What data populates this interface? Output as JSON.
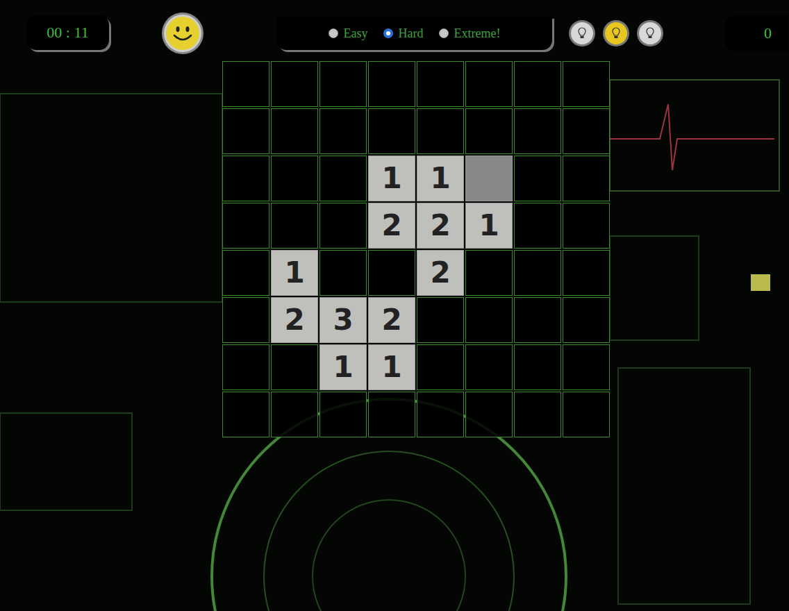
{
  "timer": "00 : 11",
  "difficulty": [
    {
      "label": "Easy",
      "selected": false
    },
    {
      "label": "Hard",
      "selected": true
    },
    {
      "label": "Extreme!",
      "selected": false
    }
  ],
  "hints": [
    {
      "selected": false
    },
    {
      "selected": true
    },
    {
      "selected": false
    }
  ],
  "score": "0",
  "board": {
    "rows": [
      [
        {
          "state": "hidden",
          "value": ""
        },
        {
          "state": "hidden",
          "value": ""
        },
        {
          "state": "hidden",
          "value": ""
        },
        {
          "state": "hidden",
          "value": ""
        },
        {
          "state": "hidden",
          "value": ""
        },
        {
          "state": "hidden",
          "value": ""
        },
        {
          "state": "hidden",
          "value": ""
        },
        {
          "state": "hidden",
          "value": ""
        }
      ],
      [
        {
          "state": "hidden",
          "value": ""
        },
        {
          "state": "hidden",
          "value": ""
        },
        {
          "state": "hidden",
          "value": ""
        },
        {
          "state": "hidden",
          "value": ""
        },
        {
          "state": "hidden",
          "value": ""
        },
        {
          "state": "hidden",
          "value": ""
        },
        {
          "state": "hidden",
          "value": ""
        },
        {
          "state": "hidden",
          "value": ""
        }
      ],
      [
        {
          "state": "hidden",
          "value": ""
        },
        {
          "state": "hidden",
          "value": ""
        },
        {
          "state": "hidden",
          "value": ""
        },
        {
          "state": "revealed",
          "value": "1"
        },
        {
          "state": "revealed",
          "value": "1"
        },
        {
          "state": "revealed",
          "value": ""
        },
        {
          "state": "hidden",
          "value": ""
        },
        {
          "state": "hidden",
          "value": ""
        }
      ],
      [
        {
          "state": "hidden",
          "value": ""
        },
        {
          "state": "hidden",
          "value": ""
        },
        {
          "state": "hidden",
          "value": ""
        },
        {
          "state": "revealed",
          "value": "2"
        },
        {
          "state": "revealed",
          "value": "2"
        },
        {
          "state": "revealed",
          "value": "1"
        },
        {
          "state": "hidden",
          "value": ""
        },
        {
          "state": "hidden",
          "value": ""
        }
      ],
      [
        {
          "state": "hidden",
          "value": ""
        },
        {
          "state": "revealed",
          "value": "1"
        },
        {
          "state": "hidden",
          "value": ""
        },
        {
          "state": "hidden",
          "value": ""
        },
        {
          "state": "revealed",
          "value": "2"
        },
        {
          "state": "hidden",
          "value": ""
        },
        {
          "state": "hidden",
          "value": ""
        },
        {
          "state": "hidden",
          "value": ""
        }
      ],
      [
        {
          "state": "hidden",
          "value": ""
        },
        {
          "state": "revealed",
          "value": "2"
        },
        {
          "state": "revealed",
          "value": "3"
        },
        {
          "state": "revealed",
          "value": "2"
        },
        {
          "state": "hidden",
          "value": ""
        },
        {
          "state": "hidden",
          "value": ""
        },
        {
          "state": "hidden",
          "value": ""
        },
        {
          "state": "hidden",
          "value": ""
        }
      ],
      [
        {
          "state": "hidden",
          "value": ""
        },
        {
          "state": "hidden",
          "value": ""
        },
        {
          "state": "revealed",
          "value": "1"
        },
        {
          "state": "revealed",
          "value": "1"
        },
        {
          "state": "hidden",
          "value": ""
        },
        {
          "state": "hidden",
          "value": ""
        },
        {
          "state": "hidden",
          "value": ""
        },
        {
          "state": "hidden",
          "value": ""
        }
      ],
      [
        {
          "state": "hidden",
          "value": ""
        },
        {
          "state": "hidden",
          "value": ""
        },
        {
          "state": "hidden",
          "value": ""
        },
        {
          "state": "hidden",
          "value": ""
        },
        {
          "state": "hidden",
          "value": ""
        },
        {
          "state": "hidden",
          "value": ""
        },
        {
          "state": "hidden",
          "value": ""
        },
        {
          "state": "hidden",
          "value": ""
        }
      ]
    ]
  }
}
